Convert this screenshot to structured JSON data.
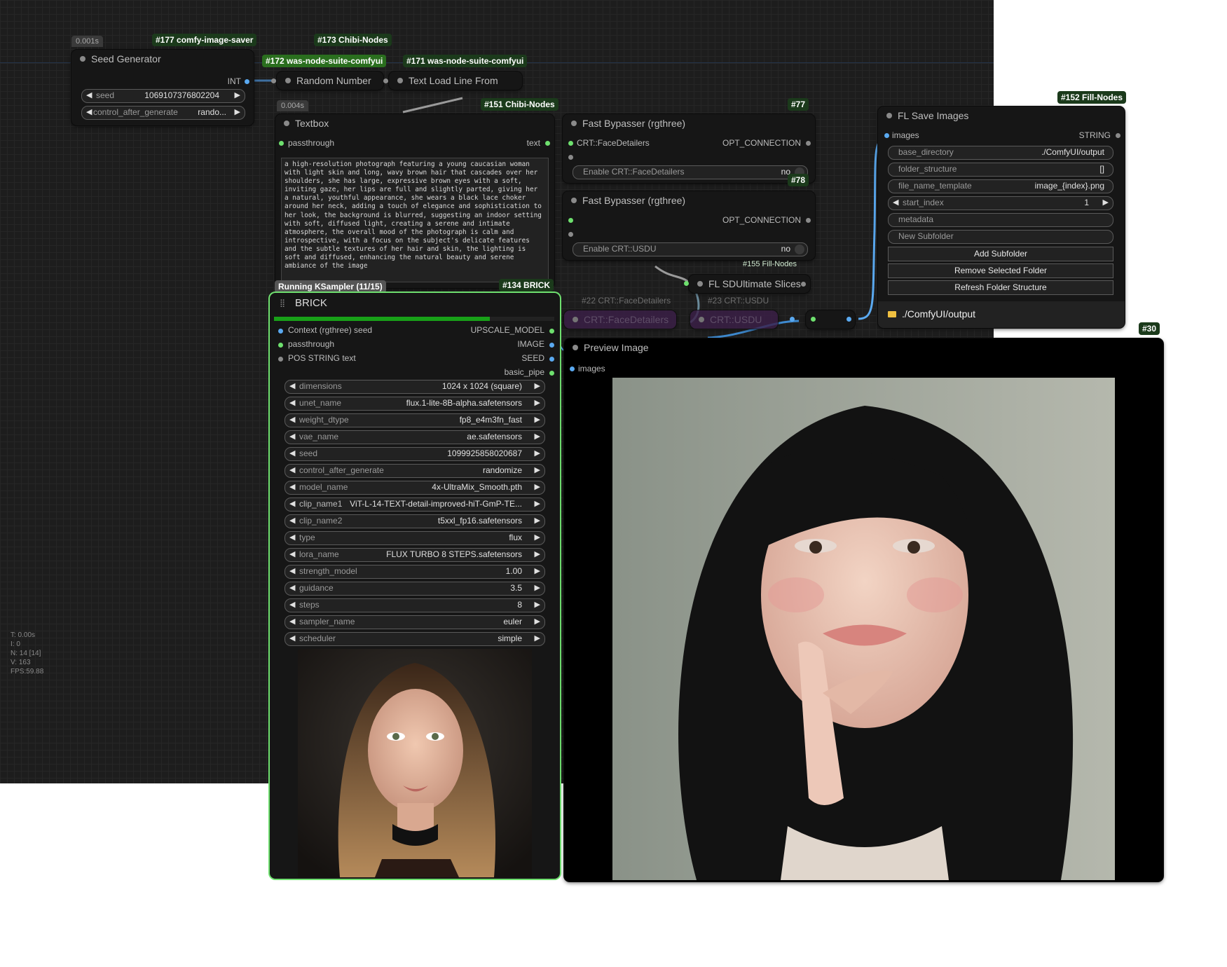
{
  "badges": {
    "n177": "#177 comfy-image-saver",
    "n173": "#173 Chibi-Nodes",
    "n172": "#172 was-node-suite-comfyui",
    "n171": "#171 was-node-suite-comfyui",
    "n151": "#151 Chibi-Nodes",
    "n77": "#77",
    "n78": "#78",
    "n152": "#152 Fill-Nodes",
    "n134": "#134 BRICK",
    "n30": "#30",
    "n155": "#155 Fill-Nodes"
  },
  "times": {
    "seed_gen": "0.001s",
    "textbox": "0.004s"
  },
  "seed_generator": {
    "title": "Seed Generator",
    "out_int": "INT",
    "seed_label": "seed",
    "seed_value": "1069107376802204",
    "cag_label": "control_after_generate",
    "cag_value": "rando..."
  },
  "random_number": {
    "title": "Random Number"
  },
  "text_load": {
    "title": "Text Load Line From"
  },
  "textbox": {
    "title": "Textbox",
    "in_passthrough": "passthrough",
    "out_text": "text",
    "content": "a high-resolution photograph featuring a young caucasian woman with light skin and long, wavy brown hair that cascades over her shoulders, she has large, expressive brown eyes with a soft, inviting gaze, her lips are full and slightly parted, giving her a natural, youthful appearance, she wears a black lace choker around her neck, adding a touch of elegance and sophistication to her look, the background is blurred, suggesting an indoor setting with soft, diffused light, creating a serene and intimate atmosphere, the overall mood of the photograph is calm and introspective, with a focus on the subject's delicate features and the subtle textures of her hair and skin, the lighting is soft and diffused, enhancing the natural beauty and serene ambiance of the image"
  },
  "bypasser1": {
    "title": "Fast Bypasser (rgthree)",
    "in1": "CRT::FaceDetailers",
    "out": "OPT_CONNECTION",
    "toggle_label": "Enable CRT::FaceDetailers",
    "toggle_value": "no"
  },
  "bypasser2": {
    "title": "Fast Bypasser (rgthree)",
    "out": "OPT_CONNECTION",
    "toggle_label": "Enable CRT::USDU",
    "toggle_value": "no"
  },
  "sdultimate": {
    "title": "FL SDUltimate Slices"
  },
  "faded": {
    "n22": "#22 CRT::FaceDetailers",
    "n23": "#23 CRT::USDU",
    "face": "CRT::FaceDetailers",
    "usdu": "CRT::USDU"
  },
  "fl_save": {
    "title": "FL Save Images",
    "in_images": "images",
    "out_string": "STRING",
    "fields": [
      {
        "label": "base_directory",
        "value": "./ComfyUI/output"
      },
      {
        "label": "folder_structure",
        "value": "[]"
      },
      {
        "label": "file_name_template",
        "value": "image_{index}.png"
      },
      {
        "label": "start_index",
        "value": "1"
      },
      {
        "label": "metadata",
        "value": ""
      },
      {
        "label": "New Subfolder",
        "value": ""
      }
    ],
    "buttons": [
      "Add Subfolder",
      "Remove Selected Folder",
      "Refresh Folder Structure"
    ],
    "folder": "./ComfyUI/output"
  },
  "brick": {
    "status": "Running KSampler (11/15)",
    "title": "BRICK",
    "progress": 0.77,
    "inputs": [
      "Context (rgthree) seed",
      "passthrough",
      "POS STRING text"
    ],
    "outputs": [
      "UPSCALE_MODEL",
      "IMAGE",
      "SEED",
      "basic_pipe"
    ],
    "widgets": [
      {
        "label": "dimensions",
        "value": "1024 x 1024  (square)"
      },
      {
        "label": "unet_name",
        "value": "flux.1-lite-8B-alpha.safetensors"
      },
      {
        "label": "weight_dtype",
        "value": "fp8_e4m3fn_fast"
      },
      {
        "label": "vae_name",
        "value": "ae.safetensors"
      },
      {
        "label": "seed",
        "value": "1099925858020687"
      },
      {
        "label": "control_after_generate",
        "value": "randomize"
      },
      {
        "label": "model_name",
        "value": "4x-UltraMix_Smooth.pth"
      },
      {
        "label": "clip_name1",
        "value": "ViT-L-14-TEXT-detail-improved-hiT-GmP-TE..."
      },
      {
        "label": "clip_name2",
        "value": "t5xxl_fp16.safetensors"
      },
      {
        "label": "type",
        "value": "flux"
      },
      {
        "label": "lora_name",
        "value": "FLUX TURBO 8 STEPS.safetensors"
      },
      {
        "label": "strength_model",
        "value": "1.00"
      },
      {
        "label": "guidance",
        "value": "3.5"
      },
      {
        "label": "steps",
        "value": "8"
      },
      {
        "label": "sampler_name",
        "value": "euler"
      },
      {
        "label": "scheduler",
        "value": "simple"
      }
    ]
  },
  "preview": {
    "title": "Preview Image",
    "in_images": "images"
  },
  "stats": [
    "T: 0.00s",
    "I: 0",
    "N: 14 [14]",
    "V: 163",
    "FPS:59.88"
  ]
}
